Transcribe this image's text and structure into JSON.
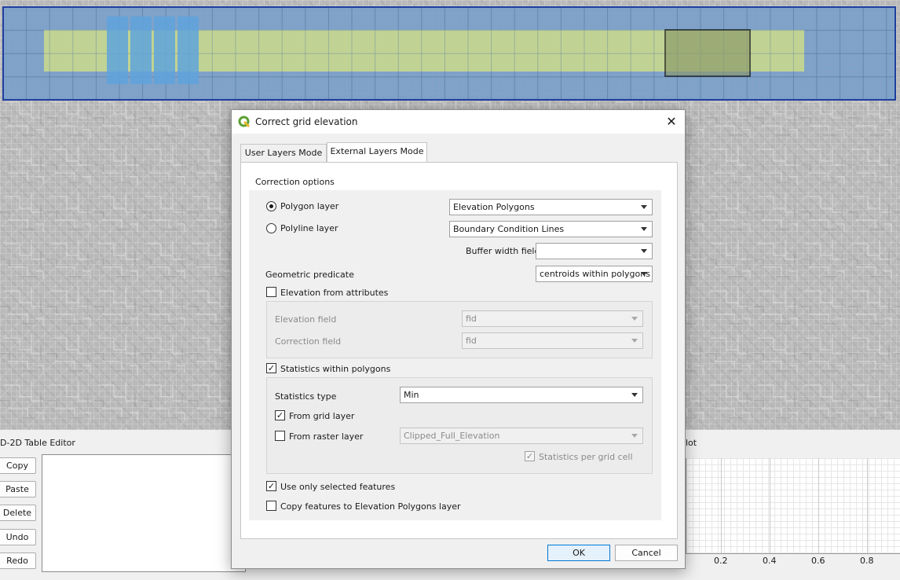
{
  "dialog": {
    "title": "Correct grid elevation",
    "tabs": [
      {
        "label": "User Layers Mode",
        "active": false
      },
      {
        "label": "External Layers Mode",
        "active": true
      }
    ],
    "group_title": "Correction options",
    "polygon_layer": {
      "label": "Polygon layer",
      "selected": true,
      "value": "Elevation Polygons"
    },
    "polyline_layer": {
      "label": "Polyline layer",
      "selected": false,
      "value": "Boundary Condition Lines"
    },
    "buffer_width": {
      "label": "Buffer width field",
      "value": ""
    },
    "geometric_predicate": {
      "label": "Geometric predicate",
      "value": "centroids within polygons"
    },
    "elevation_from_attributes": {
      "label": "Elevation from attributes",
      "checked": false
    },
    "elevation_field": {
      "label": "Elevation field",
      "value": "fid"
    },
    "correction_field": {
      "label": "Correction field",
      "value": "fid"
    },
    "statistics_within_polygons": {
      "label": "Statistics within polygons",
      "checked": true
    },
    "statistics_type": {
      "label": "Statistics type",
      "value": "Min"
    },
    "from_grid_layer": {
      "label": "From grid layer",
      "checked": true
    },
    "from_raster_layer": {
      "label": "From raster layer",
      "checked": false,
      "value": "Clipped_Full_Elevation"
    },
    "statistics_per_grid_cell": {
      "label": "Statistics per grid cell",
      "checked": true
    },
    "use_only_selected": {
      "label": "Use only selected features",
      "checked": true
    },
    "copy_features": {
      "label": "Copy features to Elevation Polygons layer",
      "checked": false
    },
    "ok_label": "OK",
    "cancel_label": "Cancel"
  },
  "table_editor": {
    "title": "D-2D Table Editor",
    "buttons": [
      "Copy",
      "Paste",
      "Delete",
      "Undo",
      "Redo"
    ]
  },
  "plot": {
    "title": "lot",
    "x_ticks": [
      "0.2",
      "0.4",
      "0.6",
      "0.8"
    ]
  },
  "colors": {
    "grid_fill": "#7d9fc4",
    "green_polygon": "#c8d98a",
    "blue_cells": "#5c9fd8",
    "dialog_bg": "#f0f0f0",
    "accent": "#0078d7"
  }
}
